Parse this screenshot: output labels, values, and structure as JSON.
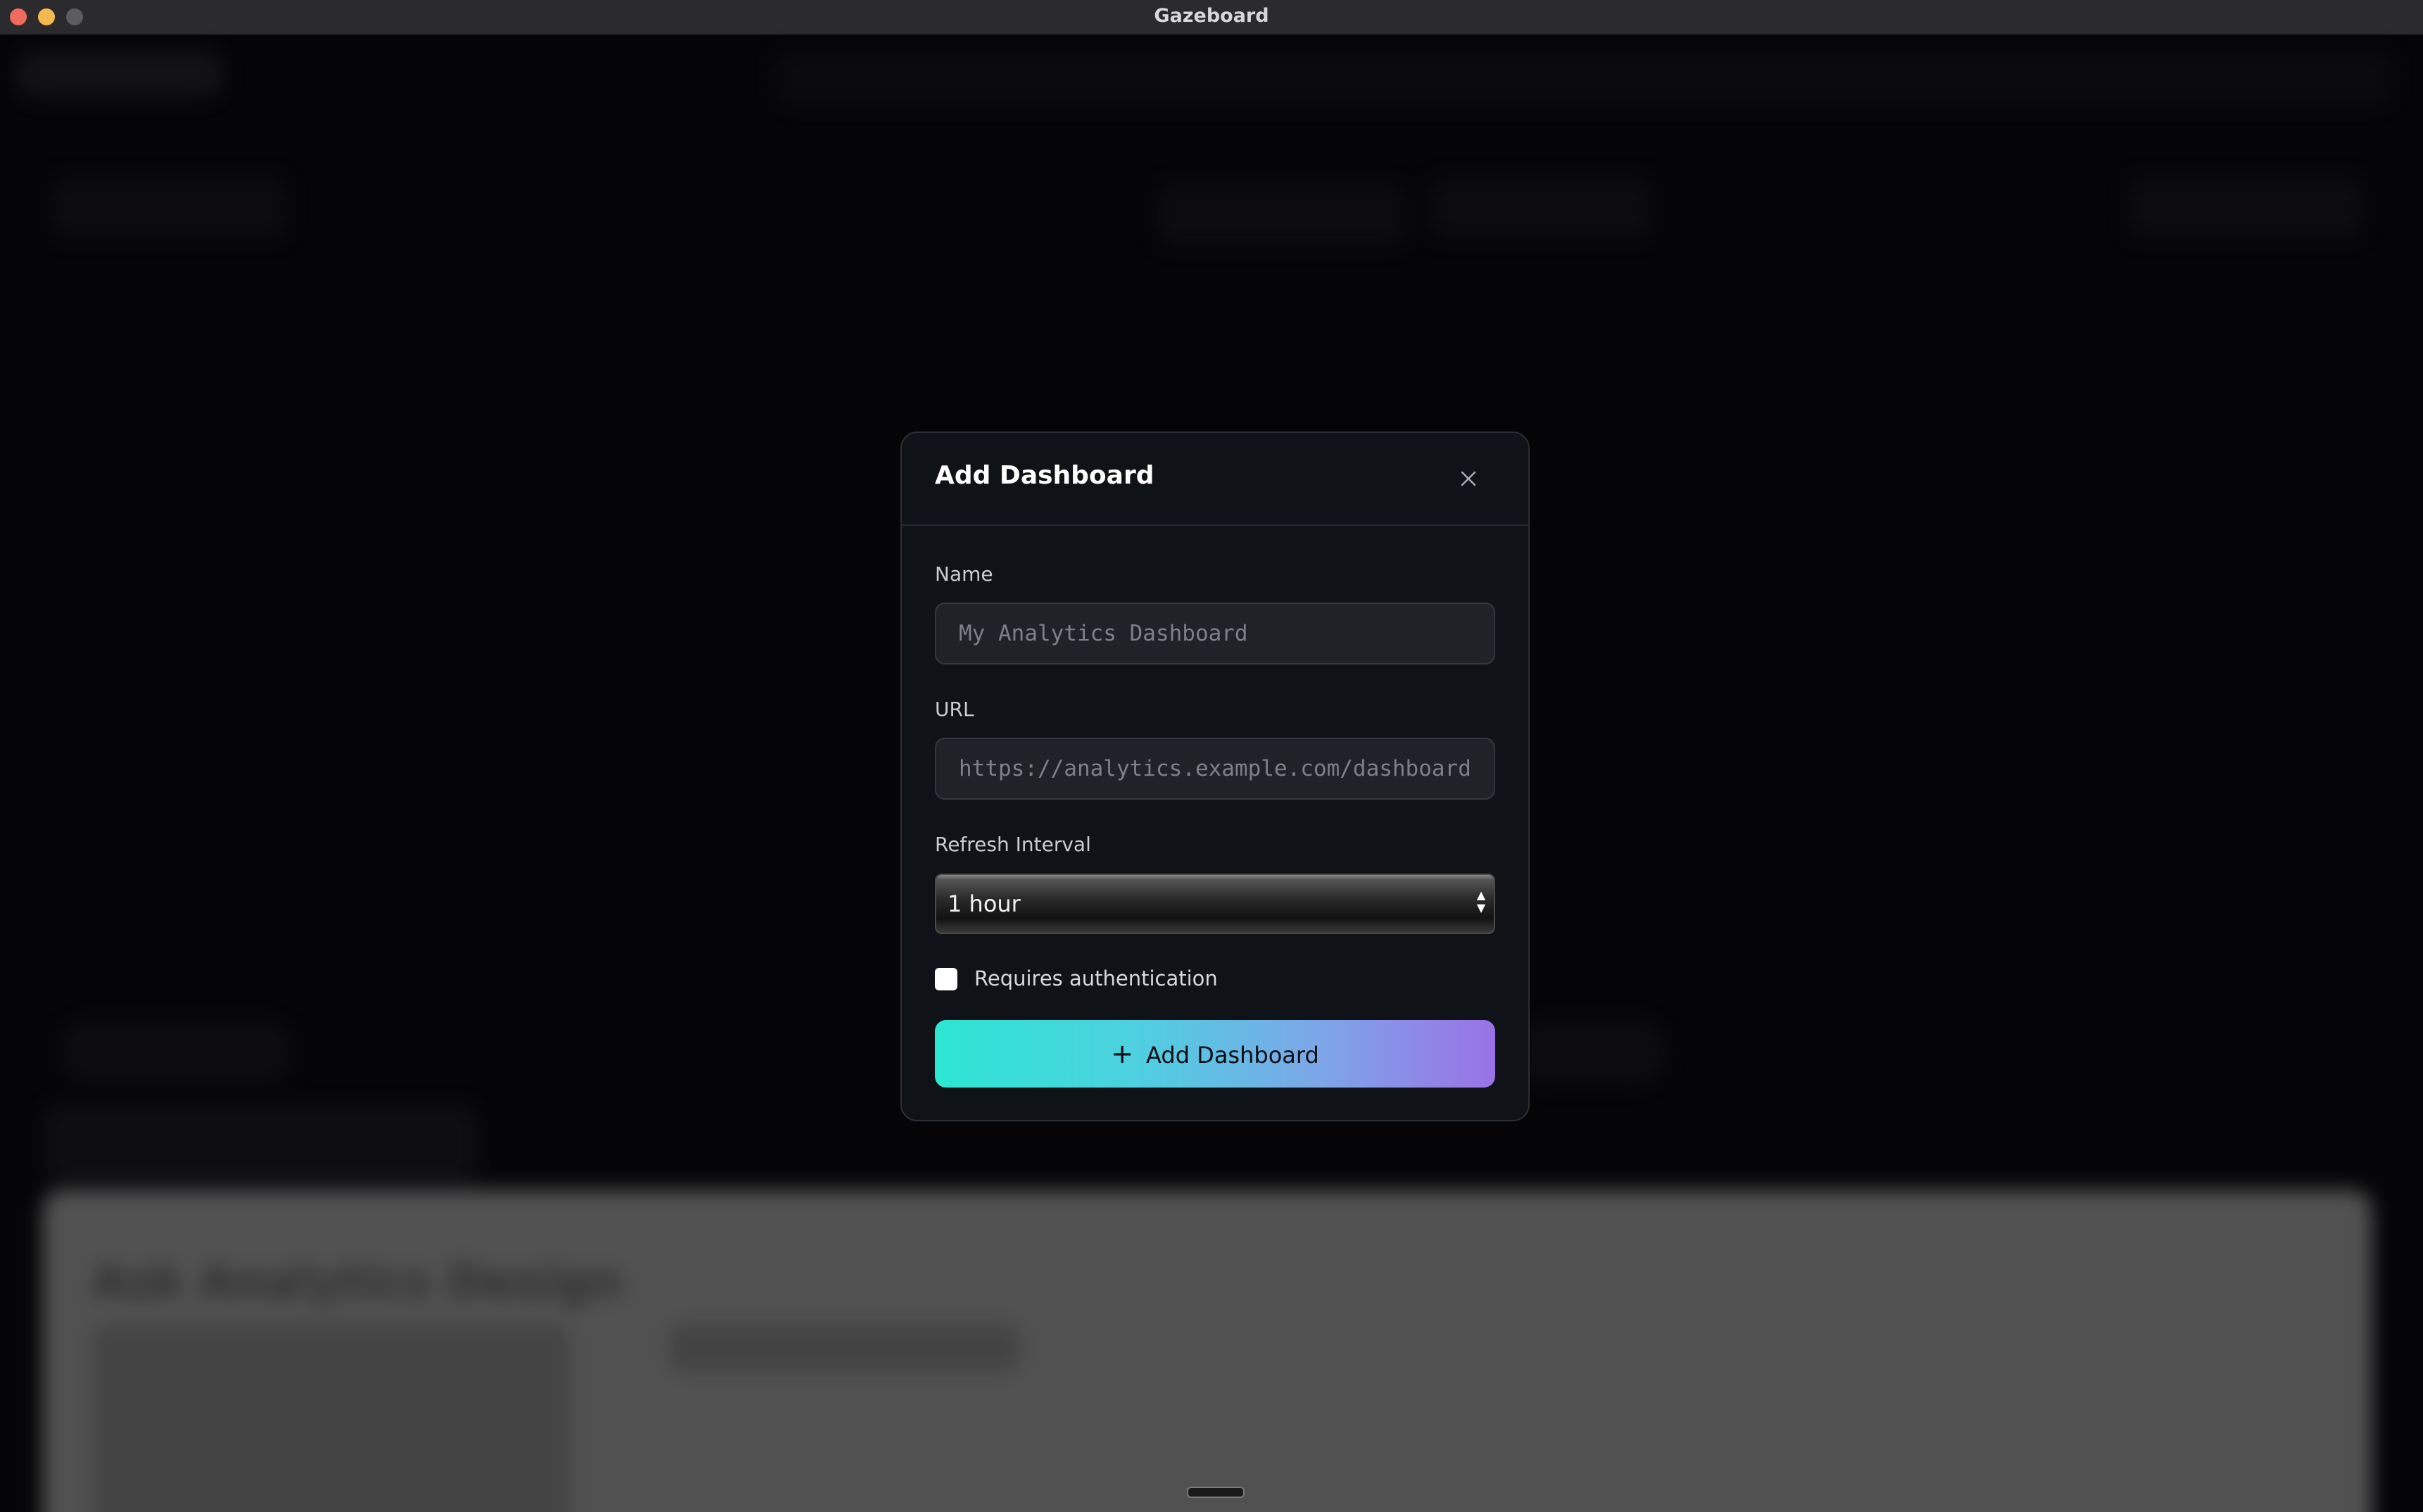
{
  "window": {
    "title": "Gazeboard"
  },
  "background": {
    "panel_title": "Ask Analytics Design"
  },
  "modal": {
    "title": "Add Dashboard",
    "close_icon": "close-icon",
    "fields": {
      "name": {
        "label": "Name",
        "value": "",
        "placeholder": "My Analytics Dashboard"
      },
      "url": {
        "label": "URL",
        "value": "",
        "placeholder": "https://analytics.example.com/dashboard"
      },
      "refresh_interval": {
        "label": "Refresh Interval",
        "selected": "1 hour"
      },
      "requires_auth": {
        "label": "Requires authentication",
        "checked": false
      }
    },
    "submit": {
      "icon": "plus-icon",
      "label": "Add Dashboard"
    }
  },
  "colors": {
    "accent_start": "#2de6d2",
    "accent_end": "#9a72e6",
    "modal_bg": "#0f1216"
  }
}
